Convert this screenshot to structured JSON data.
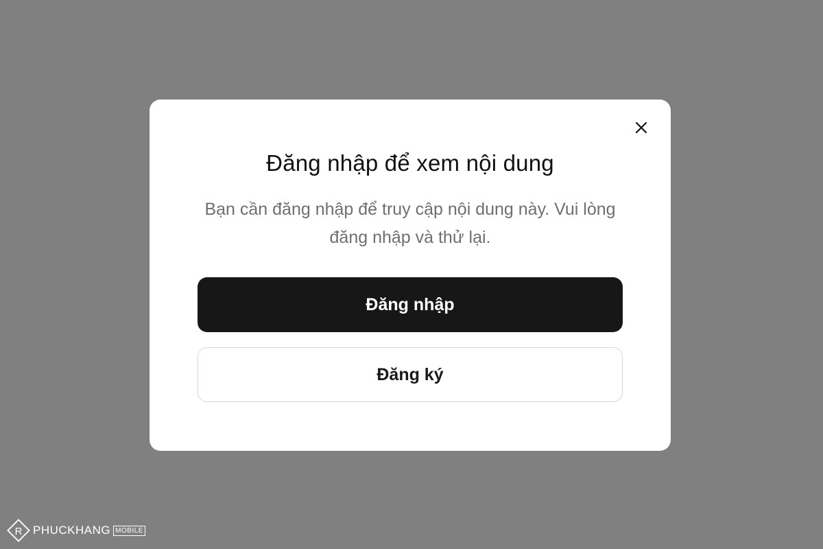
{
  "modal": {
    "title": "Đăng nhập để xem nội dung",
    "description": "Bạn cần đăng nhập để truy cập nội dung này. Vui lòng đăng nhập và thử lại.",
    "close_icon": "close-icon",
    "login_label": "Đăng nhập",
    "register_label": "Đăng ký"
  },
  "watermark": {
    "brand": "PHUCKHANG",
    "badge": "MOBILE"
  },
  "colors": {
    "overlay": "#808080",
    "modal_bg": "#ffffff",
    "primary_button": "#171717",
    "secondary_border": "#d6d6d6",
    "description_text": "#6f6f6f"
  }
}
